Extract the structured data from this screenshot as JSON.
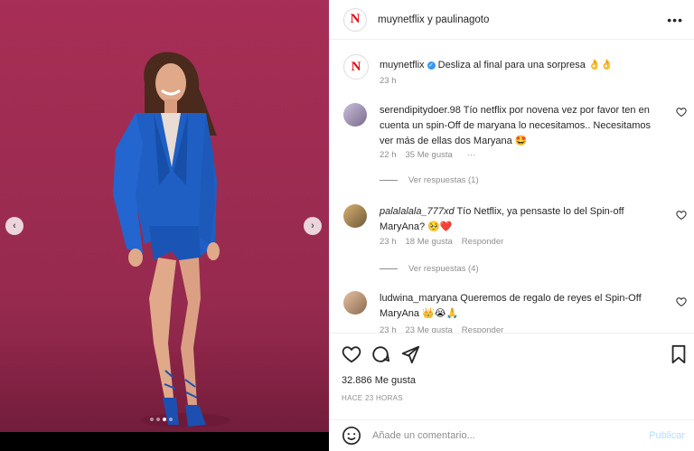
{
  "post": {
    "header_title": "muynetflix y paulinagoto",
    "carousel_dots": 4,
    "carousel_active": 2
  },
  "caption": {
    "user": "muynetflix",
    "text": "Desliza al final para una sorpresa 👌👌",
    "time": "23 h"
  },
  "comments": [
    {
      "user": "serendipitydoer.98",
      "text": "Tío netflix por novena vez por favor ten en cuenta un spin-Off de maryana lo necesitamos.. Necesitamos ver más de ellas dos Maryana 🤩",
      "time": "22 h",
      "likes": "35 Me gusta",
      "extra": "···",
      "replies": "Ver respuestas (1)"
    },
    {
      "user": "palalalala_777xd",
      "text": "Tío Netflix, ya pensaste lo del Spin-off MaryAna? 🥺❤️",
      "time": "23 h",
      "likes": "18 Me gusta",
      "reply_label": "Responder",
      "replies": "Ver respuestas (4)"
    },
    {
      "user": "ludwina_maryana",
      "text": "Queremos de regalo de reyes el Spin-Off MaryAna 👑😭🙏",
      "time": "23 h",
      "likes": "23 Me gusta",
      "reply_label": "Responder"
    }
  ],
  "stats": {
    "likes": "32.886 Me gusta",
    "ago": "HACE 23 HORAS"
  },
  "composer": {
    "placeholder": "Añade un comentario...",
    "publish": "Publicar"
  },
  "colors": {
    "brand_red": "#e50914",
    "background": "#9b2a4f",
    "muted": "#8e8e8e",
    "publish_disabled": "#b3dbff"
  },
  "icons": [
    "chevron-left-icon",
    "chevron-right-icon",
    "more-icon",
    "verified-icon",
    "heart-icon",
    "comment-icon",
    "share-icon",
    "bookmark-icon",
    "emoji-icon"
  ]
}
